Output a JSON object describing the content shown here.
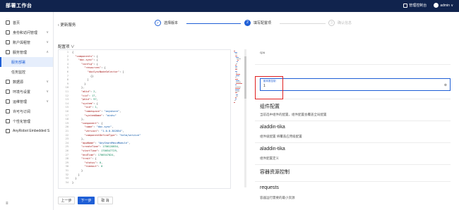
{
  "topbar": {
    "title": "部署工作台",
    "manage_label": "管理控制台",
    "user": "admin"
  },
  "sidebar": {
    "items": [
      {
        "label": "首页",
        "chevron": ""
      },
      {
        "label": "身份和访问管理",
        "chevron": "∨"
      },
      {
        "label": "账户與租管",
        "chevron": "∨"
      },
      {
        "label": "服务管理",
        "chevron": "∧"
      },
      {
        "label": "服务部署",
        "sub": true,
        "active": true
      },
      {
        "label": "任务监控",
        "sub": true
      },
      {
        "label": "数据源",
        "chevron": "∨"
      },
      {
        "label": "环境与设置",
        "chevron": "∨"
      },
      {
        "label": "运维管理",
        "chevron": "∨"
      },
      {
        "label": "许可与订阅",
        "chevron": ""
      },
      {
        "label": "个性化管理",
        "chevron": ""
      },
      {
        "label": "AnyRobot Embedded S",
        "chevron": ""
      }
    ],
    "collapse_icon": "≡"
  },
  "header": {
    "back_label": "更新服务"
  },
  "steps": [
    {
      "num": "✓",
      "label": "选择版本",
      "state": "done"
    },
    {
      "num": "2",
      "label": "填写配置项",
      "state": "active"
    },
    {
      "num": "3",
      "label": "确认信息",
      "state": "todo"
    }
  ],
  "editor": {
    "label": "配置项 ∨",
    "lines": [
      {
        "n": "1",
        "t": "{"
      },
      {
        "n": "2",
        "t": "  \"components\": {"
      },
      {
        "n": "3",
        "t": "    \"doc-sync\": {"
      },
      {
        "n": "4",
        "t": "      \"config\": {"
      },
      {
        "n": "5",
        "t": "        \"resources\": {"
      },
      {
        "n": "6",
        "t": "          \"docSyncNodeSelector\": ["
      },
      {
        "n": "7",
        "t": "            {}"
      },
      {
        "n": "8",
        "t": "          ]"
      },
      {
        "n": "9",
        "t": "        }"
      },
      {
        "n": "10",
        "t": "      },"
      },
      {
        "n": "11",
        "t": "      \"aUid\": 2,"
      },
      {
        "n": "12",
        "t": "      \"cid\": 17,"
      },
      {
        "n": "13",
        "t": "      \"pUid\": 97,"
      },
      {
        "n": "14",
        "t": "      \"system\": {"
      },
      {
        "n": "15",
        "t": "        \"sid\": 1,"
      },
      {
        "n": "16",
        "t": "        \"namespace\": \"anyshare\","
      },
      {
        "n": "17",
        "t": "        \"systemName\": \"aishu\""
      },
      {
        "n": "18",
        "t": "      },"
      },
      {
        "n": "19",
        "t": "      \"component\": {"
      },
      {
        "n": "20",
        "t": "        \"name\": \"doc-sync\","
      },
      {
        "n": "21",
        "t": "        \"version\": \"1.0.0-302854\","
      },
      {
        "n": "22",
        "t": "        \"componentDefineType\": \"helm/service\""
      },
      {
        "n": "23",
        "t": "      },"
      },
      {
        "n": "24",
        "t": "      \"appName\": \"AnyShareMainModule\","
      },
      {
        "n": "25",
        "t": "      \"createTime\": 1706120854,"
      },
      {
        "n": "26",
        "t": "      \"startTime\": 1706547729,"
      },
      {
        "n": "27",
        "t": "      \"endTime\": 1706547824,"
      },
      {
        "n": "28",
        "t": "      \"trait\": {"
      },
      {
        "n": "29",
        "t": "        \"status\": 0,"
      },
      {
        "n": "30",
        "t": "        \"timeout\": 0"
      },
      {
        "n": "31",
        "t": "      }"
      },
      {
        "n": "32",
        "t": "    }"
      },
      {
        "n": "33",
        "t": "  }"
      },
      {
        "n": "34",
        "t": "}"
      }
    ]
  },
  "buttons": {
    "prev": "上一步",
    "next": "下一步",
    "cancel": "取 消"
  },
  "panel": {
    "top_text": "cpu",
    "field_label": "副本数控制",
    "field_value": "1",
    "clear_icon": "⊗",
    "sections": [
      {
        "title": "组件配置",
        "desc": "当前选中组件的配置，组件配置会覆盖全局配置"
      },
      {
        "title": "aladdin-tika",
        "desc": "组件级配置 将覆盖应用级配置"
      },
      {
        "title": "aladdin-tika",
        "desc": "组件配置定义"
      },
      {
        "title": "容器资源控制",
        "desc": ""
      },
      {
        "title": "requests",
        "desc": "容器运行需要的最小资源"
      }
    ]
  },
  "colors": {
    "primary": "#1f5fd6",
    "topbar": "#10234d",
    "highlight": "#e02020"
  }
}
